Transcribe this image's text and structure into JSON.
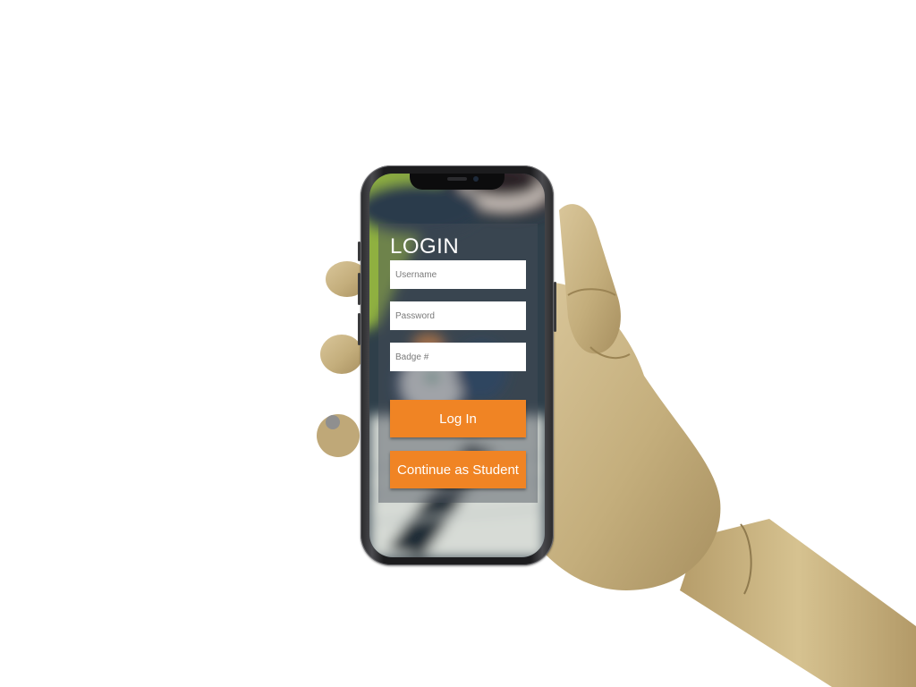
{
  "login": {
    "title": "LOGIN",
    "username_placeholder": "Username",
    "password_placeholder": "Password",
    "badge_placeholder": "Badge #",
    "login_button": "Log In",
    "student_button": "Continue as Student"
  },
  "colors": {
    "accent": "#f08424",
    "panel_overlay": "#464e58",
    "field_background": "#ffffff"
  }
}
